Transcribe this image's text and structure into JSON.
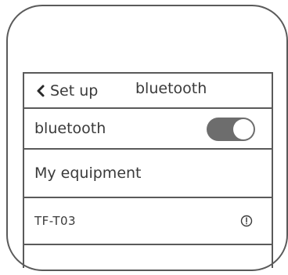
{
  "header": {
    "back_label": "Set up",
    "title": "bluetooth"
  },
  "bluetooth_row": {
    "label": "bluetooth",
    "toggle_on": true
  },
  "section": {
    "label": "My equipment"
  },
  "devices": [
    {
      "name": "TF-T03",
      "icon": "info-icon"
    }
  ],
  "colors": {
    "outline": "#5a5a5a",
    "text": "#3a3a3a",
    "toggle_track": "#6d6d6d",
    "toggle_knob": "#ffffff"
  }
}
